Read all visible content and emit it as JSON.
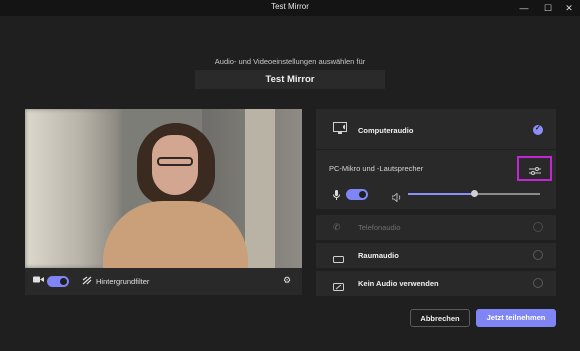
{
  "window": {
    "title": "Test Mirror"
  },
  "header": {
    "subtitle": "Audio- und Videoeinstellungen auswählen für",
    "meeting_name": "Test Mirror"
  },
  "video_controls": {
    "camera_on": true,
    "background_filter_label": "Hintergrundfilter"
  },
  "audio": {
    "computer_audio_label": "Computeraudio",
    "device_label": "PC-Mikro und -Lautsprecher",
    "mic_on": true,
    "volume_level": 0.5,
    "phone_audio_label": "Telefonaudio",
    "room_audio_label": "Raumaudio",
    "no_audio_label": "Kein Audio verwenden",
    "selected": "computer_audio"
  },
  "actions": {
    "cancel_label": "Abbrechen",
    "join_label": "Jetzt teilnehmen"
  },
  "colors": {
    "accent": "#7f85f5",
    "highlight_border": "#c026d3",
    "background": "#1f1f1f"
  }
}
